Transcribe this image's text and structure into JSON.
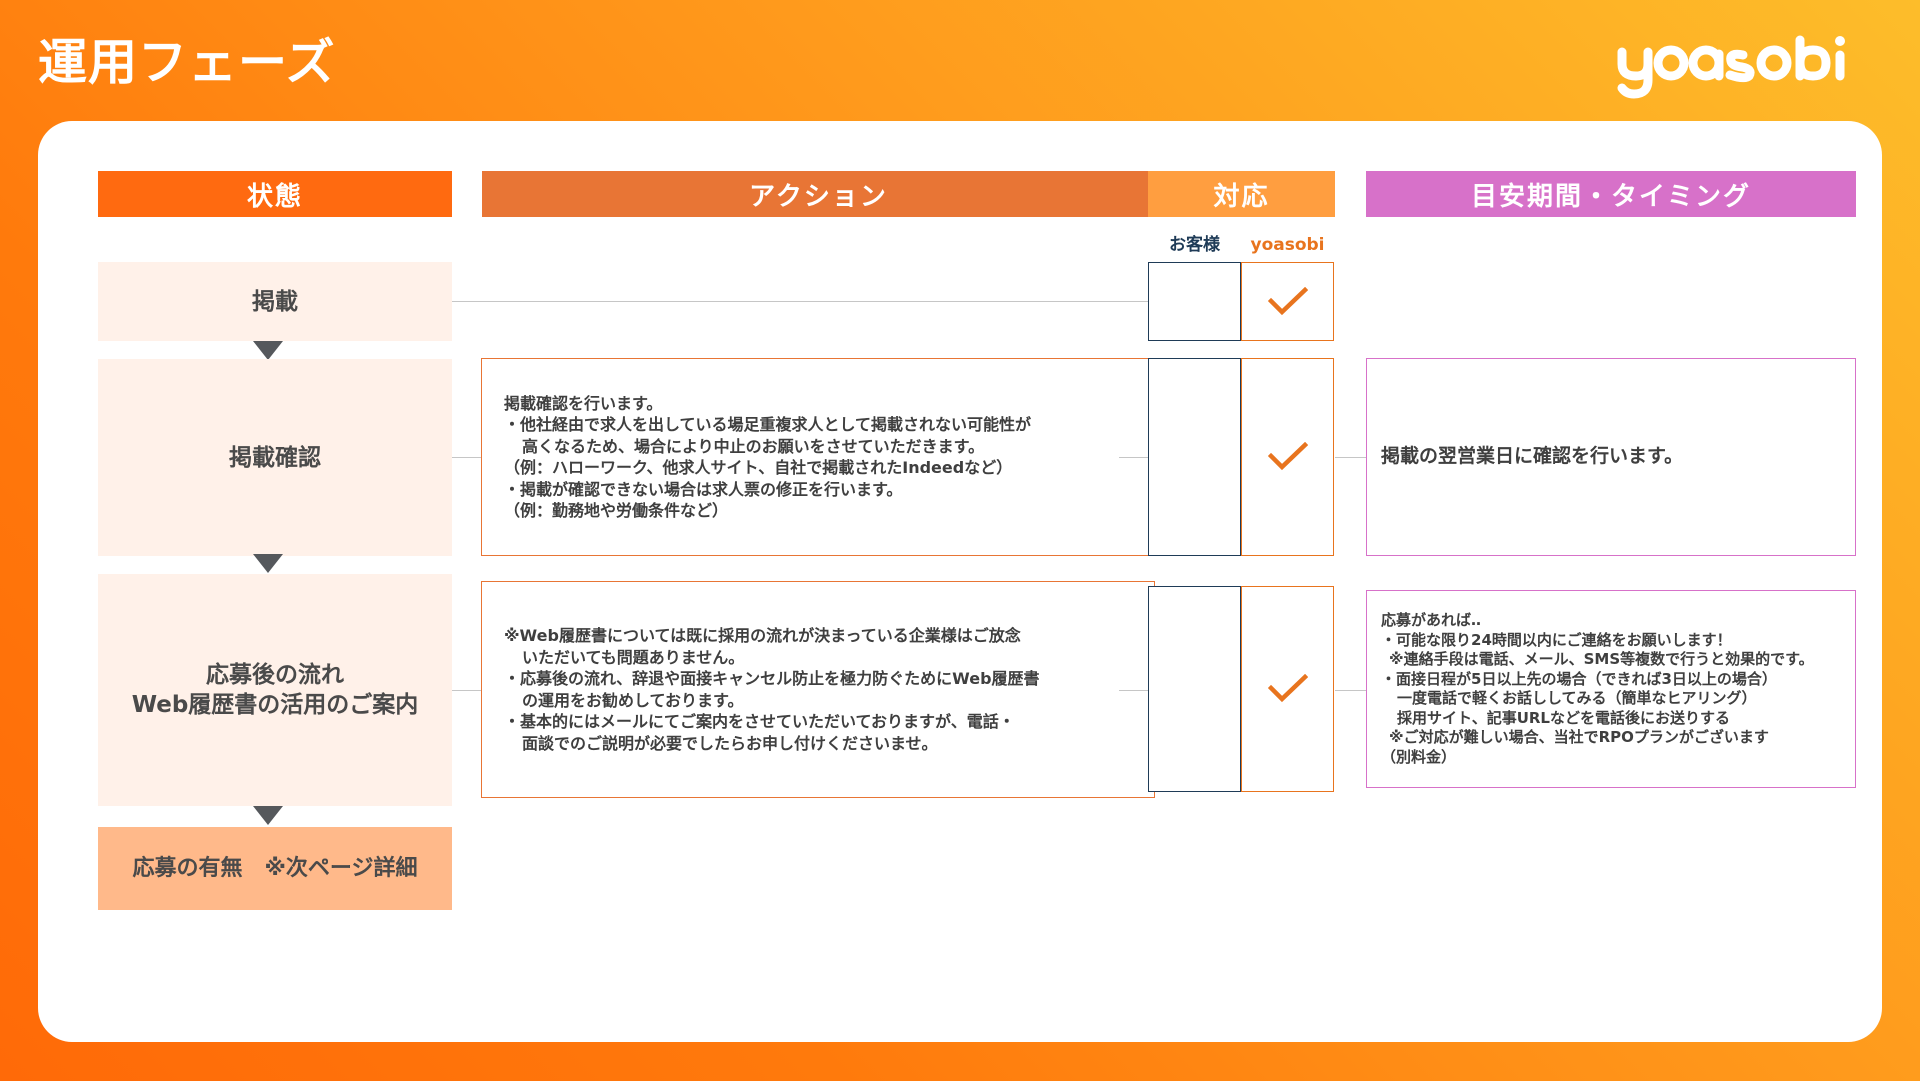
{
  "slide": {
    "title": "運用フェーズ",
    "logo_text": "yoasobi"
  },
  "headers": {
    "status": "状態",
    "action": "アクション",
    "response": "対応",
    "timing": "目安期間・タイミング"
  },
  "response_labels": {
    "customer": "お客様",
    "yoasobi": "yoasobi"
  },
  "rows": {
    "posting": {
      "status": "掲載",
      "customer_checked": false,
      "yoasobi_checked": true
    },
    "posting_check": {
      "status": "掲載確認",
      "action_lines": [
        "掲載確認を行います。",
        "・他社経由で求人を出している場足重複求人として掲載されない可能性が",
        "高くなるため、場合により中止のお願いをさせていただきます。",
        "（例：ハローワーク、他求人サイト、自社で掲載されたIndeedなど）",
        "・掲載が確認できない場合は求人票の修正を行います。",
        "（例：勤務地や労働条件など）"
      ],
      "customer_checked": false,
      "yoasobi_checked": true,
      "timing": "掲載の翌営業日に確認を行います。"
    },
    "after_application": {
      "status_line1": "応募後の流れ",
      "status_line2": "Web履歴書の活用のご案内",
      "action_lines": [
        "※Web履歴書については既に採用の流れが決まっている企業様はご放念",
        "いただいても問題ありません。",
        "・応募後の流れ、辞退や面接キャンセル防止を極力防ぐためにWeb履歴書",
        "の運用をお勧めしております。",
        "・基本的にはメールにてご案内をさせていただいておりますが、電話・",
        "面談でのご説明が必要でしたらお申し付けくださいませ。"
      ],
      "customer_checked": false,
      "yoasobi_checked": true,
      "timing_lines": [
        "応募があれば‥",
        "・可能な限り24時間以内にご連絡をお願いします！",
        "※連絡手段は電話、メール、SMS等複数で行うと効果的です。",
        "・面接日程が5日以上先の場合（できれば3日以上の場合）",
        "一度電話で軽くお話ししてみる（簡単なヒアリング）",
        "採用サイト、記事URLなどを電話後にお送りする",
        "※ご対応が難しい場合、当社でRPOプランがございます",
        "（別料金）"
      ]
    },
    "application_result": {
      "status": "応募の有無　※次ページ詳細"
    }
  },
  "colors": {
    "status_header": "#ff6a10",
    "action_header": "#e87535",
    "response_header": "#ff9e40",
    "timing_header": "#d771c9",
    "customer_border": "#1f3b57",
    "yoasobi_accent": "#e8741e",
    "status_box_fill": "#fff1e9",
    "final_status_fill": "#ffb98a"
  },
  "icons": {
    "check": "check-icon",
    "arrow": "arrow-down-icon",
    "logo": "yoasobi-logo"
  }
}
